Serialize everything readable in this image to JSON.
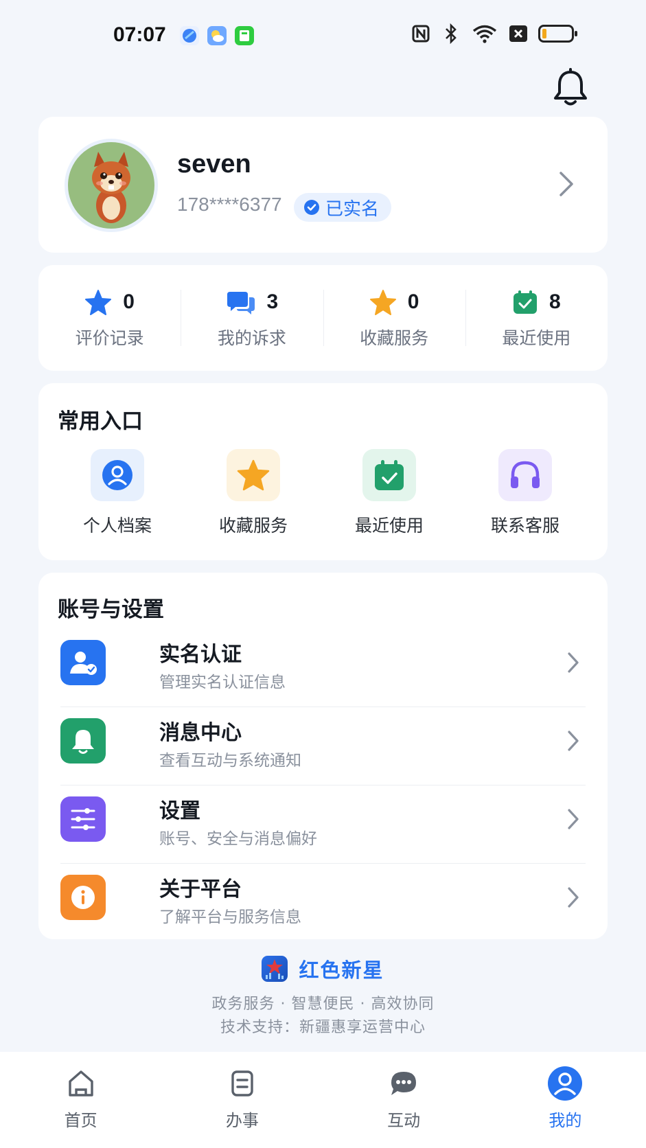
{
  "status_bar": {
    "time": "07:07"
  },
  "profile": {
    "username": "seven",
    "phone": "178****6377",
    "verified_label": "已实名"
  },
  "stats": [
    {
      "icon": "star-icon",
      "count": "0",
      "label": "评价记录",
      "color": "#2773f0"
    },
    {
      "icon": "chat-bubbles-icon",
      "count": "3",
      "label": "我的诉求",
      "color": "#2773f0"
    },
    {
      "icon": "star-icon",
      "count": "0",
      "label": "收藏服务",
      "color": "#f5a623"
    },
    {
      "icon": "calendar-check-icon",
      "count": "8",
      "label": "最近使用",
      "color": "#22a06b"
    }
  ],
  "common_entries": {
    "title": "常用入口",
    "items": [
      {
        "icon": "person-icon",
        "label": "个人档案",
        "color": "#2773f0"
      },
      {
        "icon": "star-icon",
        "label": "收藏服务",
        "color": "#f5a623"
      },
      {
        "icon": "calendar-check-icon",
        "label": "最近使用",
        "color": "#22a06b"
      },
      {
        "icon": "headset-icon",
        "label": "联系客服",
        "color": "#7a5af0"
      }
    ]
  },
  "account_settings": {
    "title": "账号与设置",
    "items": [
      {
        "icon": "id-verify-icon",
        "title": "实名认证",
        "subtitle": "管理实名认证信息",
        "color": "#2773f0"
      },
      {
        "icon": "bell-icon",
        "title": "消息中心",
        "subtitle": "查看互动与系统通知",
        "color": "#22a06b"
      },
      {
        "icon": "sliders-icon",
        "title": "设置",
        "subtitle": "账号、安全与消息偏好",
        "color": "#7a5af0"
      },
      {
        "icon": "info-icon",
        "title": "关于平台",
        "subtitle": "了解平台与服务信息",
        "color": "#f58a2c"
      }
    ]
  },
  "brand": {
    "name": "红色新星",
    "tagline": "政务服务 · 智慧便民 · 高效协同",
    "support": "技术支持：新疆惠享运营中心"
  },
  "tab_bar": {
    "tabs": [
      {
        "icon": "home-icon",
        "label": "首页"
      },
      {
        "icon": "document-icon",
        "label": "办事"
      },
      {
        "icon": "chat-icon",
        "label": "互动"
      },
      {
        "icon": "user-icon",
        "label": "我的"
      }
    ],
    "active_index": 3
  },
  "colors": {
    "accent": "#2773f0",
    "background": "#f3f6fb"
  }
}
